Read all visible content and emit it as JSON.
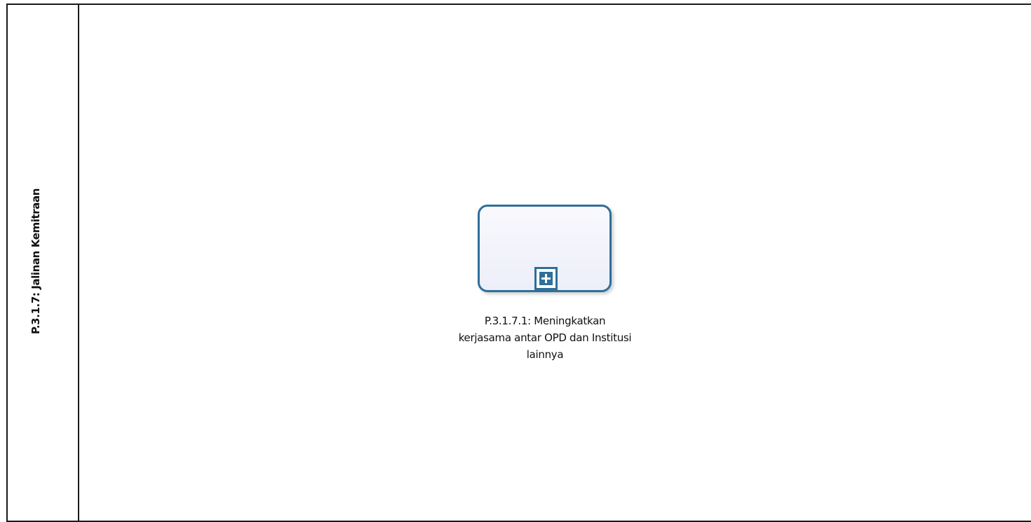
{
  "pool": {
    "title": "P.3.1.7: Jalinan Kemitraan"
  },
  "task": {
    "label_lines": [
      "P.3.1.7.1: Meningkatkan",
      "kerjasama antar OPD dan Institusi",
      "lainnya"
    ],
    "marker": "plus-icon",
    "colors": {
      "border": "#2f6f9a",
      "fill": "#f3f4fb"
    }
  }
}
